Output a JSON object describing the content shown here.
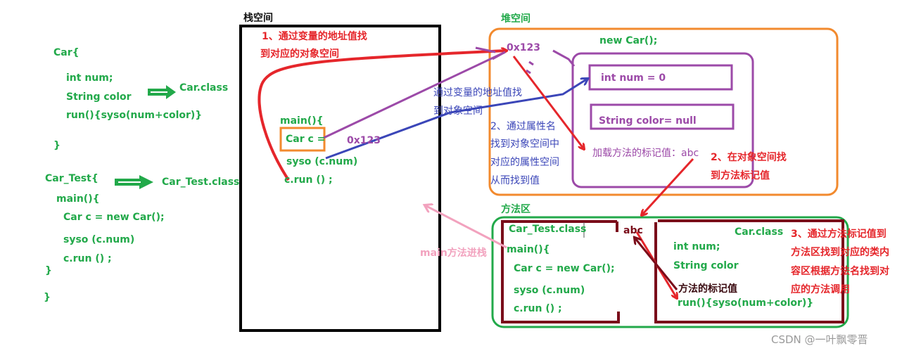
{
  "source_code": {
    "car_class": {
      "header": "Car{",
      "fields": [
        "int num;",
        "String color",
        "run(){syso(num+color)}"
      ],
      "close": "}",
      "compiles_to": "Car.class"
    },
    "car_test_class": {
      "header": "Car_Test{",
      "main": "main(){",
      "lines": [
        "Car  c  = new  Car();",
        "syso  (c.num)",
        "c.run  ()  ;"
      ],
      "close_inner": "}",
      "close_outer": "}",
      "compiles_to": "Car_Test.class"
    }
  },
  "stack": {
    "title": "栈空间",
    "note_1": [
      "1、通过变量的地址值找",
      "到对应的对象空间"
    ],
    "main": "main(){",
    "var_decl": "Car  c  =",
    "address": "0x123",
    "line_syso": "syso  (c.num)",
    "line_run": "c.run  ()  ;"
  },
  "heap": {
    "title": "堆空间",
    "address": "0x123",
    "new_label": "new  Car();",
    "field_num": "int  num  = 0",
    "field_color": "String color= null",
    "method_marker": "加载方法的标记值：abc",
    "note_blue": [
      "通过变量的地址值找",
      "到对象空间"
    ],
    "note_2": [
      "2、通过属性名",
      "找到对象空间中",
      "对应的属性空间",
      "从而找到值"
    ],
    "note_2b": [
      "2、在对象空间找",
      "到方法标记值"
    ]
  },
  "method_area": {
    "title": "方法区",
    "car_test": {
      "title": "Car_Test.class",
      "main": "main(){",
      "lines": [
        "Car  c  = new  Car();",
        "syso  (c.num)",
        "c.run  ()  ;"
      ]
    },
    "marker": "abc",
    "car": {
      "title": "Car.class",
      "fields": [
        "int num;",
        "String color"
      ],
      "method_marker_label": "方法的标记值",
      "method": "run(){syso(num+color)}"
    },
    "note_3": [
      "3、通过方法标记值到",
      "方法区找到对应的类内",
      "容区根据方法名找到对",
      "应的方法调用"
    ],
    "push_label": "main方法进栈"
  },
  "colors": {
    "code_green": "#22a94a",
    "red": "#e5262b",
    "purple": "#9c4aa8",
    "blue": "#3b46b8",
    "orange": "#f28a2e",
    "dark_red": "#7a0c1a",
    "pink": "#f2a2be",
    "black": "#000000"
  },
  "watermark": "CSDN @一叶飘零晋"
}
